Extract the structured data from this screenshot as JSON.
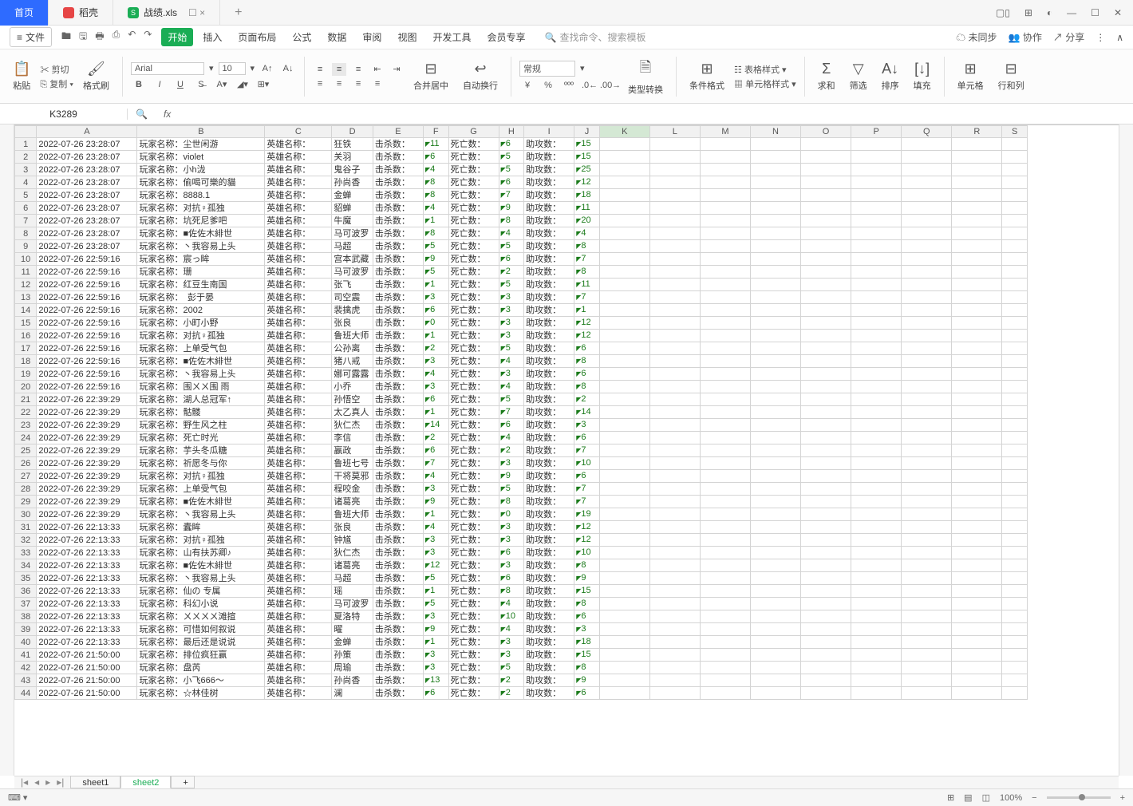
{
  "titlebar": {
    "home": "首页",
    "daoke": "稻壳",
    "file": "战绩.xls"
  },
  "menu": {
    "file": "文件",
    "start": "开始",
    "insert": "插入",
    "layout": "页面布局",
    "formula": "公式",
    "data": "数据",
    "review": "审阅",
    "view": "视图",
    "devtools": "开发工具",
    "member": "会员专享",
    "search_ph": "查找命令、搜索模板",
    "unsync": "未同步",
    "coop": "协作",
    "share": "分享"
  },
  "ribbon": {
    "paste": "粘贴",
    "cut": "剪切",
    "copy": "复制",
    "fmtbrush": "格式刷",
    "font": "Arial",
    "size": "10",
    "merge": "合并居中",
    "wrap": "自动换行",
    "numfmt": "常规",
    "typeconv": "类型转换",
    "condfmt": "条件格式",
    "tablestyle": "表格样式",
    "cellstyle": "单元格样式",
    "sum": "求和",
    "filter": "筛选",
    "sort": "排序",
    "fill": "填充",
    "cells": "单元格",
    "rowcol": "行和列"
  },
  "namebox": "K3289",
  "fx": "fx",
  "cols": [
    "",
    "A",
    "B",
    "C",
    "D",
    "E",
    "F",
    "G",
    "H",
    "I",
    "J",
    "K",
    "L",
    "M",
    "N",
    "O",
    "P",
    "Q",
    "R",
    "S"
  ],
  "labels": {
    "player": "玩家名称：",
    "hero": "英雄名称：",
    "kills": "击杀数：",
    "deaths": "死亡数：",
    "assists": "助攻数："
  },
  "rows": [
    {
      "ts": "2022-07-26 23:28:07",
      "p": "尘世闲游",
      "h": "狂铁",
      "k": "11",
      "d": "6",
      "a": "15"
    },
    {
      "ts": "2022-07-26 23:28:07",
      "p": "violet",
      "h": "关羽",
      "k": "6",
      "d": "5",
      "a": "15"
    },
    {
      "ts": "2022-07-26 23:28:07",
      "p": "小h泷",
      "h": "鬼谷子",
      "k": "4",
      "d": "5",
      "a": "25"
    },
    {
      "ts": "2022-07-26 23:28:07",
      "p": "偷喝可樂的貓",
      "h": "孙尚香",
      "k": "8",
      "d": "6",
      "a": "12"
    },
    {
      "ts": "2022-07-26 23:28:07",
      "p": "8888.1",
      "h": "金蝉",
      "k": "8",
      "d": "7",
      "a": "18"
    },
    {
      "ts": "2022-07-26 23:28:07",
      "p": "对抗♀孤独",
      "h": "貂蝉",
      "k": "4",
      "d": "9",
      "a": "11"
    },
    {
      "ts": "2022-07-26 23:28:07",
      "p": "坑死尼爹吧",
      "h": "牛魔",
      "k": "1",
      "d": "8",
      "a": "20"
    },
    {
      "ts": "2022-07-26 23:28:07",
      "p": "■佐佐木緋世",
      "h": "马可波罗",
      "k": "8",
      "d": "4",
      "a": "4"
    },
    {
      "ts": "2022-07-26 23:28:07",
      "p": "丶我容易上头",
      "h": "马超",
      "k": "5",
      "d": "5",
      "a": "8"
    },
    {
      "ts": "2022-07-26 22:59:16",
      "p": "宸っ眸",
      "h": "宫本武藏",
      "k": "9",
      "d": "6",
      "a": "7"
    },
    {
      "ts": "2022-07-26 22:59:16",
      "p": "珊",
      "h": "马可波罗",
      "k": "5",
      "d": "2",
      "a": "8"
    },
    {
      "ts": "2022-07-26 22:59:16",
      "p": "红豆生南国",
      "h": "张飞",
      "k": "1",
      "d": "5",
      "a": "11"
    },
    {
      "ts": "2022-07-26 22:59:16",
      "p": "　彭于晏",
      "h": "司空震",
      "k": "3",
      "d": "3",
      "a": "7"
    },
    {
      "ts": "2022-07-26 22:59:16",
      "p": "2002",
      "h": "裴擒虎",
      "k": "6",
      "d": "3",
      "a": "1"
    },
    {
      "ts": "2022-07-26 22:59:16",
      "p": "小町小野",
      "h": "张良",
      "k": "0",
      "d": "3",
      "a": "12"
    },
    {
      "ts": "2022-07-26 22:59:16",
      "p": "对抗♀孤独",
      "h": "鲁班大师",
      "k": "1",
      "d": "3",
      "a": "12"
    },
    {
      "ts": "2022-07-26 22:59:16",
      "p": "上单受气包",
      "h": "公孙离",
      "k": "2",
      "d": "5",
      "a": "6"
    },
    {
      "ts": "2022-07-26 22:59:16",
      "p": "■佐佐木緋世",
      "h": "猪八戒",
      "k": "3",
      "d": "4",
      "a": "8"
    },
    {
      "ts": "2022-07-26 22:59:16",
      "p": "丶我容易上头",
      "h": "娜可露露",
      "k": "4",
      "d": "3",
      "a": "6"
    },
    {
      "ts": "2022-07-26 22:59:16",
      "p": "围ㄨㄨ围 雨",
      "h": "小乔",
      "k": "3",
      "d": "4",
      "a": "8"
    },
    {
      "ts": "2022-07-26 22:39:29",
      "p": "湖人总冠军↑",
      "h": "孙悟空",
      "k": "6",
      "d": "5",
      "a": "2"
    },
    {
      "ts": "2022-07-26 22:39:29",
      "p": "骷髅",
      "h": "太乙真人",
      "k": "1",
      "d": "7",
      "a": "14"
    },
    {
      "ts": "2022-07-26 22:39:29",
      "p": "野生风之柱",
      "h": "狄仁杰",
      "k": "14",
      "d": "6",
      "a": "3"
    },
    {
      "ts": "2022-07-26 22:39:29",
      "p": "死亡时光",
      "h": "李信",
      "k": "2",
      "d": "4",
      "a": "6"
    },
    {
      "ts": "2022-07-26 22:39:29",
      "p": "芋头冬瓜糖",
      "h": "嬴政",
      "k": "6",
      "d": "2",
      "a": "7"
    },
    {
      "ts": "2022-07-26 22:39:29",
      "p": "祈愿冬与你",
      "h": "鲁班七号",
      "k": "7",
      "d": "3",
      "a": "10"
    },
    {
      "ts": "2022-07-26 22:39:29",
      "p": "对抗♀孤独",
      "h": "干将莫邪",
      "k": "4",
      "d": "9",
      "a": "6"
    },
    {
      "ts": "2022-07-26 22:39:29",
      "p": "上单受气包",
      "h": "程咬金",
      "k": "3",
      "d": "5",
      "a": "7"
    },
    {
      "ts": "2022-07-26 22:39:29",
      "p": "■佐佐木緋世",
      "h": "诸葛亮",
      "k": "9",
      "d": "8",
      "a": "7"
    },
    {
      "ts": "2022-07-26 22:39:29",
      "p": "丶我容易上头",
      "h": "鲁班大师",
      "k": "1",
      "d": "0",
      "a": "19"
    },
    {
      "ts": "2022-07-26 22:13:33",
      "p": "蠹眸",
      "h": "张良",
      "k": "4",
      "d": "3",
      "a": "12"
    },
    {
      "ts": "2022-07-26 22:13:33",
      "p": "对抗♀孤独",
      "h": "钟馗",
      "k": "3",
      "d": "3",
      "a": "12"
    },
    {
      "ts": "2022-07-26 22:13:33",
      "p": "山有扶苏卿♪",
      "h": "狄仁杰",
      "k": "3",
      "d": "6",
      "a": "10"
    },
    {
      "ts": "2022-07-26 22:13:33",
      "p": "■佐佐木緋世",
      "h": "诸葛亮",
      "k": "12",
      "d": "3",
      "a": "8"
    },
    {
      "ts": "2022-07-26 22:13:33",
      "p": "丶我容易上头",
      "h": "马超",
      "k": "5",
      "d": "6",
      "a": "9"
    },
    {
      "ts": "2022-07-26 22:13:33",
      "p": "仙の 专属",
      "h": "瑶",
      "k": "1",
      "d": "8",
      "a": "15"
    },
    {
      "ts": "2022-07-26 22:13:33",
      "p": "科幻小说",
      "h": "马可波罗",
      "k": "5",
      "d": "4",
      "a": "8"
    },
    {
      "ts": "2022-07-26 22:13:33",
      "p": "ㄨㄨㄨㄨ滩揎",
      "h": "夏洛特",
      "k": "3",
      "d": "10",
      "a": "6"
    },
    {
      "ts": "2022-07-26 22:13:33",
      "p": "可惜如何叙说",
      "h": "曜",
      "k": "9",
      "d": "4",
      "a": "3"
    },
    {
      "ts": "2022-07-26 22:13:33",
      "p": "最后还是说说",
      "h": "金蝉",
      "k": "1",
      "d": "3",
      "a": "18"
    },
    {
      "ts": "2022-07-26 21:50:00",
      "p": "排位疯狂赢",
      "h": "孙策",
      "k": "3",
      "d": "3",
      "a": "15"
    },
    {
      "ts": "2022-07-26 21:50:00",
      "p": "盘芮",
      "h": "周瑜",
      "k": "3",
      "d": "5",
      "a": "8"
    },
    {
      "ts": "2022-07-26 21:50:00",
      "p": "小飞666～",
      "h": "孙尚香",
      "k": "13",
      "d": "2",
      "a": "9"
    },
    {
      "ts": "2022-07-26 21:50:00",
      "p": "☆林佳树",
      "h": "澜",
      "k": "6",
      "d": "2",
      "a": "6"
    }
  ],
  "sheettabs": {
    "s1": "sheet1",
    "s2": "sheet2"
  },
  "status": {
    "zoom": "100%"
  }
}
